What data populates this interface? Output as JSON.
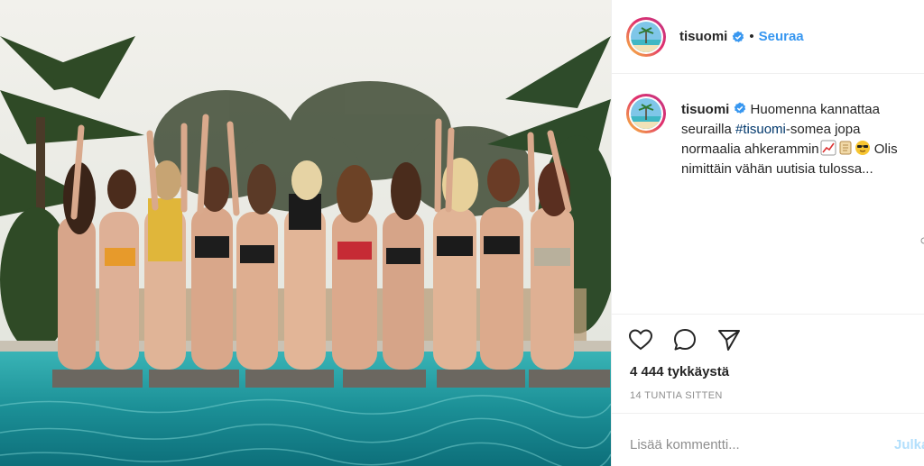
{
  "post": {
    "username": "tisuomi",
    "verified": true,
    "dot": "•",
    "follow_label": "Seuraa",
    "photo_icon": "beach-photo",
    "caption": {
      "text_before_hashtag": "Huomenna kannattaa seurailla ",
      "hashtag": "#tisuomi",
      "text_after_hashtag": "-somea jopa normaalia ahkerammin",
      "emojis": [
        "chart-emoji",
        "scroll-emoji",
        "sunglasses-emoji"
      ],
      "text_after_emojis": " Olis nimittäin vähän uutisia tulossa..."
    },
    "likes": "4 444 tykkäystä",
    "timestamp": "14 TUNTIA SITTEN",
    "comment_placeholder": "Lisää kommentti...",
    "publish_label": "Julkaise"
  },
  "icons": [
    "heart-icon",
    "comment-icon",
    "share-icon"
  ],
  "colors": {
    "link_blue": "#3897f0",
    "hashtag": "#00376b",
    "muted": "#8e8e8e",
    "border": "#efefef",
    "publish_disabled": "#b2dffc"
  }
}
